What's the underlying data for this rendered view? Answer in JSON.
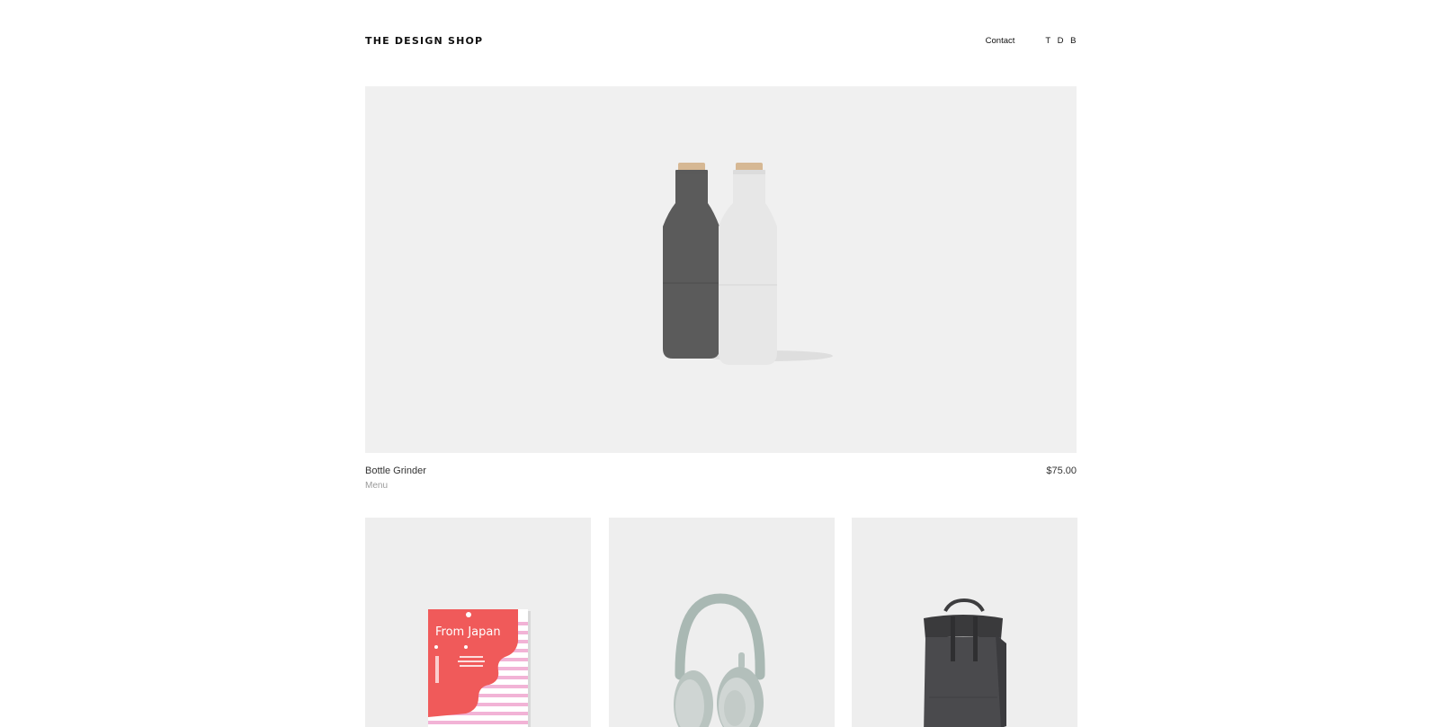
{
  "header": {
    "logo": "THE DESIGN SHOP",
    "nav": [
      {
        "label": "Contact"
      },
      {
        "label": "T D B"
      }
    ]
  },
  "featured": {
    "name": "Bottle Grinder",
    "brand": "Menu",
    "price": "$75.00"
  },
  "grid": {
    "book_cover_text": "From Japan"
  },
  "colors": {
    "image_background": "#f0f0f0",
    "card_background": "#eeeeee",
    "book_red": "#f05a5a",
    "book_pink": "#f2b3d6"
  }
}
